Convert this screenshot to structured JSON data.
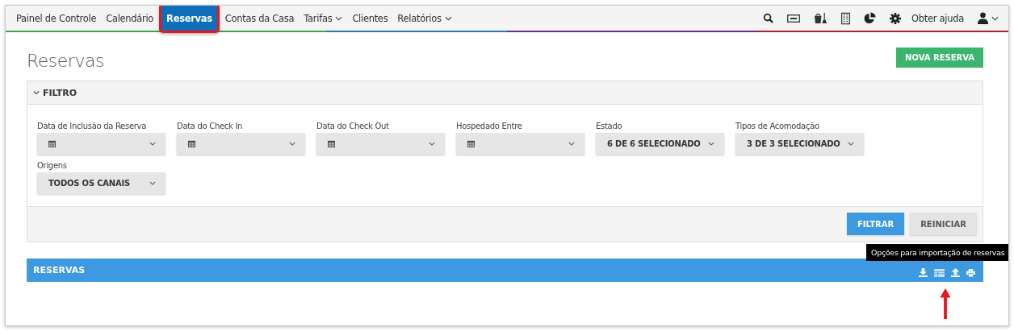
{
  "nav": {
    "items": [
      {
        "label": "Painel de Controle",
        "selected": false,
        "has_menu": false,
        "highlighted": false
      },
      {
        "label": "Calendário",
        "selected": false,
        "has_menu": false,
        "highlighted": false
      },
      {
        "label": "Reservas",
        "selected": true,
        "has_menu": false,
        "highlighted": true
      },
      {
        "label": "Contas da Casa",
        "selected": false,
        "has_menu": false,
        "highlighted": false
      },
      {
        "label": "Tarifas",
        "selected": false,
        "has_menu": true,
        "highlighted": false
      },
      {
        "label": "Clientes",
        "selected": false,
        "has_menu": false,
        "highlighted": false
      },
      {
        "label": "Relatórios",
        "selected": false,
        "has_menu": true,
        "highlighted": false
      }
    ],
    "help": "Obter ajuda"
  },
  "page": {
    "title": "Reservas",
    "new_button": "NOVA RESERVA"
  },
  "filter": {
    "title": "FILTRO",
    "expanded": true,
    "fields": [
      {
        "label": "Data de Inclusão da Reserva",
        "kind": "date"
      },
      {
        "label": "Data do Check In",
        "kind": "date"
      },
      {
        "label": "Data do Check Out",
        "kind": "date"
      },
      {
        "label": "Hospedado Entre",
        "kind": "date"
      },
      {
        "label": "Estado",
        "kind": "select",
        "value": "6 DE 6 SELECIONADO"
      },
      {
        "label": "Tipos de Acomodação",
        "kind": "select",
        "value": "3 DE 3 SELECIONADO"
      },
      {
        "label": "Origens",
        "kind": "select",
        "value": "TODOS OS CANAIS"
      }
    ],
    "buttons": [
      {
        "label": "FILTRAR",
        "kind": "primary"
      },
      {
        "label": "REINICIAR",
        "kind": "secondary"
      }
    ]
  },
  "results": {
    "title": "RESERVAS",
    "tooltip": "Opções para importação de reservas"
  }
}
